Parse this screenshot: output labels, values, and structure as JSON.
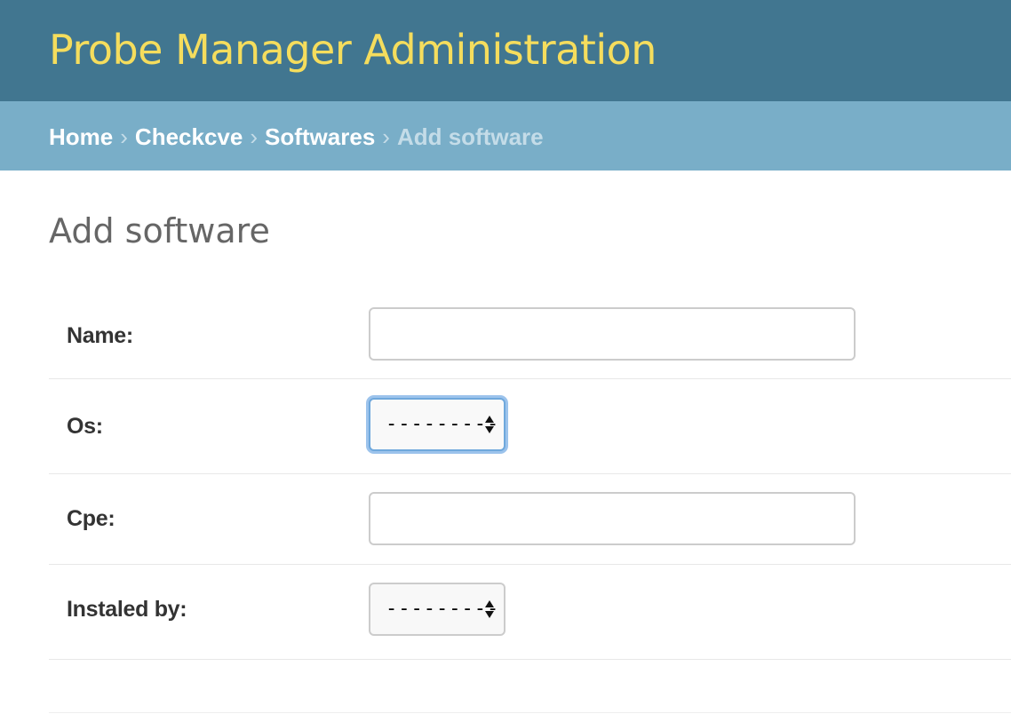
{
  "header": {
    "site_title": "Probe Manager Administration"
  },
  "breadcrumbs": {
    "items": [
      "Home",
      "Checkcve",
      "Softwares"
    ],
    "separator": "›",
    "current": "Add software"
  },
  "page": {
    "title": "Add software"
  },
  "form": {
    "name": {
      "label": "Name:",
      "value": ""
    },
    "os": {
      "label": "Os:",
      "selected": "---------",
      "focused": true
    },
    "cpe": {
      "label": "Cpe:",
      "value": ""
    },
    "instaled_by": {
      "label": "Instaled by:",
      "selected": "---------"
    }
  },
  "colors": {
    "header_bg": "#417690",
    "site_title": "#f5dd5d",
    "breadcrumb_bg": "#79aec8",
    "focus_ring": "#9cc3ec"
  },
  "icons": {
    "select_arrows": "updown-arrows-icon"
  }
}
